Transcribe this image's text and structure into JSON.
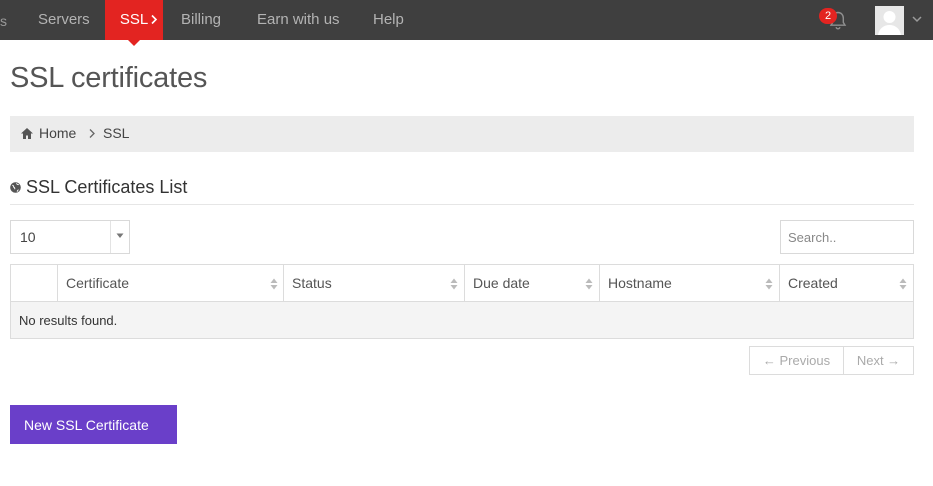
{
  "nav": {
    "edge_glyph": "s",
    "items": [
      {
        "label": "Servers",
        "active": false
      },
      {
        "label": "SSL",
        "active": true
      },
      {
        "label": "Billing",
        "active": false
      },
      {
        "label": "Earn with us",
        "active": false
      },
      {
        "label": "Help",
        "active": false
      }
    ],
    "notification_count": "2",
    "icons": {
      "notifications": "bell-icon",
      "avatar": "user-avatar",
      "menu": "chevron-down-icon"
    }
  },
  "page": {
    "title": "SSL certificates"
  },
  "breadcrumb": {
    "home": "Home",
    "current": "SSL",
    "home_icon": "home-icon",
    "separator_icon": "chevron-right-icon"
  },
  "section": {
    "title": "SSL Certificates List",
    "icon": "globe-icon"
  },
  "controls": {
    "page_size": "10",
    "search_placeholder": "Search.."
  },
  "table": {
    "columns": [
      "",
      "Certificate",
      "Status",
      "Due date",
      "Hostname",
      "Created"
    ],
    "empty_message": "No results found."
  },
  "pagination": {
    "previous": "← Previous",
    "next": "Next →"
  },
  "actions": {
    "new_certificate": "New SSL Certificate"
  },
  "colors": {
    "nav_bg": "#3f3f3f",
    "accent": "#e32421",
    "primary_button": "#6a3fc9",
    "breadcrumb_bg": "#ececec"
  }
}
